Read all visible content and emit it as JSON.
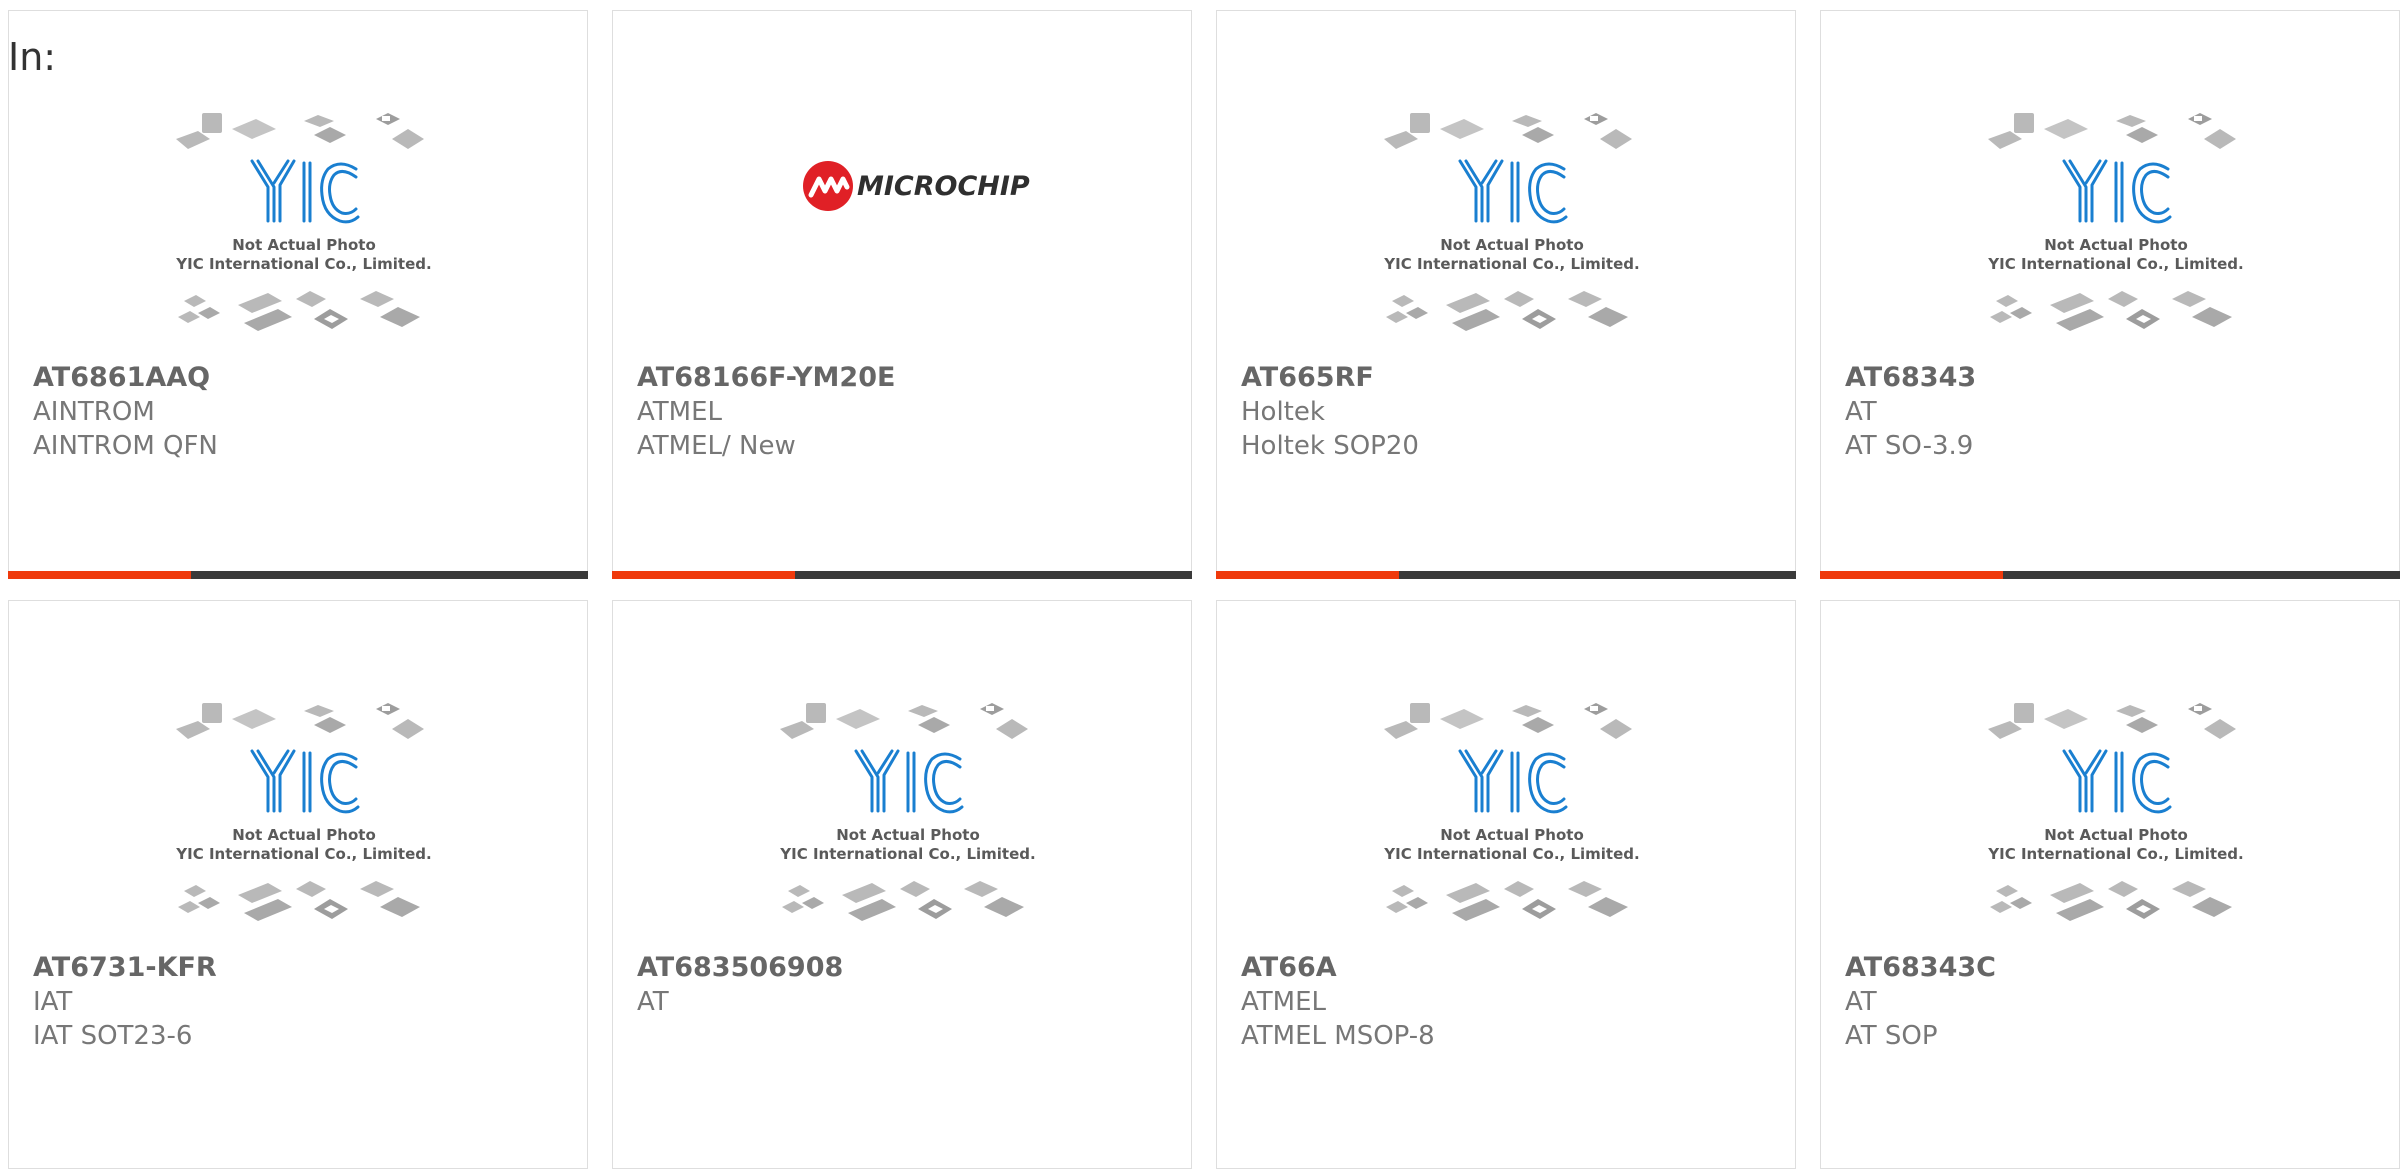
{
  "header": {
    "in_label": "In:"
  },
  "placeholder": {
    "logo_text": "YIC",
    "line1": "Not Actual Photo",
    "line2": "YIC International Co., Limited."
  },
  "colors": {
    "accent": "#ef3a0c",
    "bar_dark": "#3a3a3a",
    "logo_blue": "#1a7fd0"
  },
  "products": [
    {
      "part": "AT6861AAQ",
      "maker": "AINTROM",
      "package": "AINTROM QFN",
      "image": "yic-placeholder"
    },
    {
      "part": "AT68166F-YM20E",
      "maker": "ATMEL",
      "package": "ATMEL/ New",
      "image": "microchip-logo",
      "logo_text": "MICROCHIP"
    },
    {
      "part": "AT665RF",
      "maker": "Holtek",
      "package": "Holtek SOP20",
      "image": "yic-placeholder"
    },
    {
      "part": "AT68343",
      "maker": "AT",
      "package": "AT SO-3.9",
      "image": "yic-placeholder"
    },
    {
      "part": "AT6731-KFR",
      "maker": "IAT",
      "package": "IAT SOT23-6",
      "image": "yic-placeholder"
    },
    {
      "part": "AT683506908",
      "maker": "AT",
      "package": "",
      "image": "yic-placeholder"
    },
    {
      "part": "AT66A",
      "maker": "ATMEL",
      "package": "ATMEL MSOP-8",
      "image": "yic-placeholder"
    },
    {
      "part": "AT68343C",
      "maker": "AT",
      "package": "AT SOP",
      "image": "yic-placeholder"
    }
  ]
}
